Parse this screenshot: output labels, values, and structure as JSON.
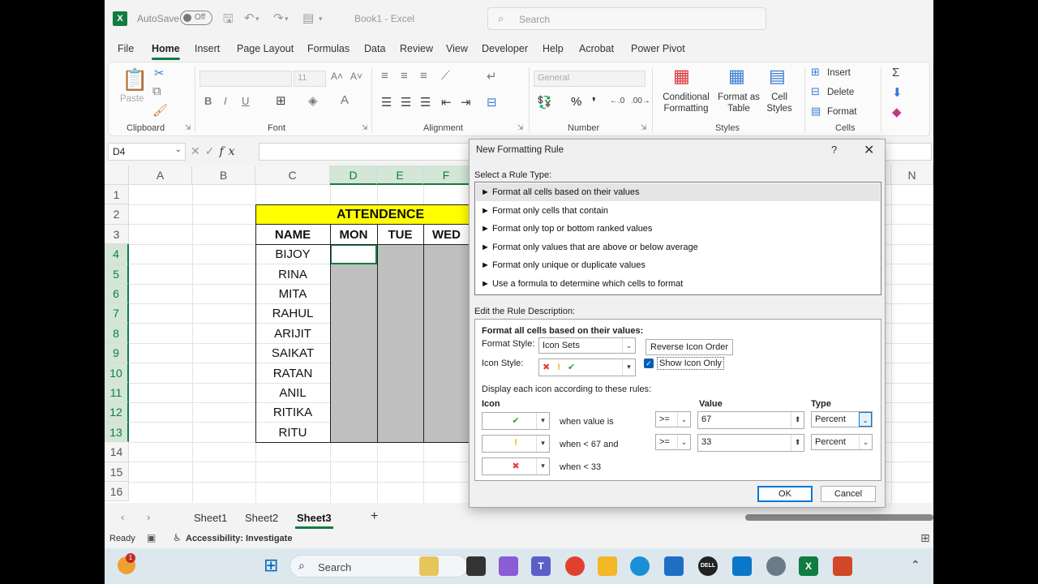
{
  "titlebar": {
    "app_icon": "X",
    "autosave_label": "AutoSave",
    "autosave_state": "Off",
    "doc_title": "Book1  -  Excel",
    "search_placeholder": "Search"
  },
  "menu": {
    "tabs": [
      "File",
      "Home",
      "Insert",
      "Page Layout",
      "Formulas",
      "Data",
      "Review",
      "View",
      "Developer",
      "Help",
      "Acrobat",
      "Power Pivot"
    ],
    "active": "Home"
  },
  "ribbon": {
    "clipboard": {
      "label": "Clipboard",
      "paste": "Paste"
    },
    "font": {
      "label": "Font",
      "size": "11"
    },
    "alignment": {
      "label": "Alignment"
    },
    "number": {
      "label": "Number",
      "format": "General"
    },
    "styles": {
      "label": "Styles",
      "conditional_formatting": "Conditional Formatting",
      "format_as_table": "Format as Table",
      "cell_styles": "Cell Styles"
    },
    "cells": {
      "label": "Cells",
      "insert": "Insert",
      "delete": "Delete",
      "format": "Format"
    }
  },
  "formula_bar": {
    "name_box": "D4",
    "fx": "fx"
  },
  "grid": {
    "columns": [
      "A",
      "B",
      "C",
      "D",
      "E",
      "F",
      "N"
    ],
    "rows": [
      "1",
      "2",
      "3",
      "4",
      "5",
      "6",
      "7",
      "8",
      "9",
      "10",
      "11",
      "12",
      "13",
      "14",
      "15",
      "16"
    ],
    "table_title": "ATTENDENCE",
    "headers": [
      "NAME",
      "MON",
      "TUE",
      "WED"
    ],
    "names": [
      "BIJOY",
      "RINA",
      "MITA",
      "RAHUL",
      "ARIJIT",
      "SAIKAT",
      "RATAN",
      "ANIL",
      "RITIKA",
      "RITU"
    ]
  },
  "sheets": {
    "tabs": [
      "Sheet1",
      "Sheet2",
      "Sheet3"
    ],
    "active": "Sheet3",
    "add": "+"
  },
  "status": {
    "ready": "Ready",
    "accessibility": "Accessibility: Investigate"
  },
  "taskbar": {
    "search": "Search",
    "notification_count": "1"
  },
  "dialog": {
    "title": "New Formatting Rule",
    "help": "?",
    "close": "✕",
    "select_rule_type_label": "Select a Rule Type:",
    "rule_types": [
      "► Format all cells based on their values",
      "► Format only cells that contain",
      "► Format only top or bottom ranked values",
      "► Format only values that are above or below average",
      "► Format only unique or duplicate values",
      "► Use a formula to determine which cells to format"
    ],
    "edit_desc_label": "Edit the Rule Description:",
    "desc_heading": "Format all cells based on their values:",
    "format_style_label": "Format Style:",
    "format_style_value": "Icon Sets",
    "reverse_icon_order": "Reverse Icon Order",
    "icon_style_label": "Icon Style:",
    "show_icon_only": "Show Icon Only",
    "display_rule_label": "Display each icon according to these rules:",
    "col_icon": "Icon",
    "col_value": "Value",
    "col_type": "Type",
    "rules": [
      {
        "icon": "✔",
        "when": "when value is",
        "op": ">=",
        "value": "67",
        "type": "Percent"
      },
      {
        "icon": "!",
        "when": "when < 67 and",
        "op": ">=",
        "value": "33",
        "type": "Percent"
      },
      {
        "icon": "✖",
        "when": "when < 33"
      }
    ],
    "ok": "OK",
    "cancel": "Cancel"
  },
  "colors": {
    "excel_green": "#107c41",
    "yellow": "#ffff00",
    "gray_fill": "#c0c0c0"
  }
}
